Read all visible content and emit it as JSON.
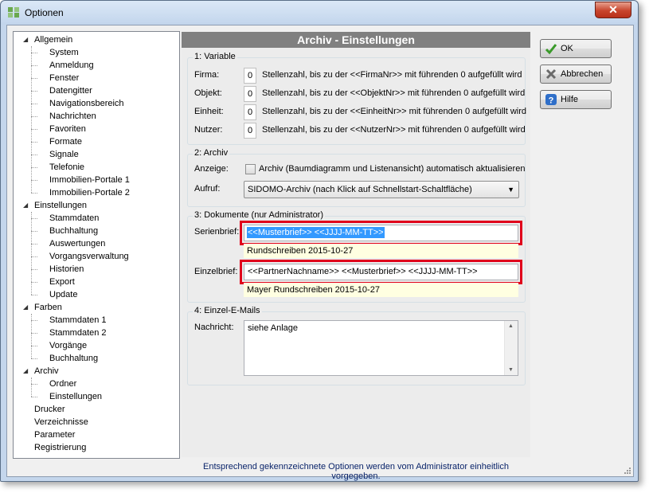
{
  "window": {
    "title": "Optionen",
    "close_glyph": "✕"
  },
  "tree": [
    {
      "label": "Allgemein",
      "level": 0,
      "expanded": true
    },
    {
      "label": "System",
      "level": 1
    },
    {
      "label": "Anmeldung",
      "level": 1
    },
    {
      "label": "Fenster",
      "level": 1
    },
    {
      "label": "Datengitter",
      "level": 1
    },
    {
      "label": "Navigationsbereich",
      "level": 1
    },
    {
      "label": "Nachrichten",
      "level": 1
    },
    {
      "label": "Favoriten",
      "level": 1
    },
    {
      "label": "Formate",
      "level": 1
    },
    {
      "label": "Signale",
      "level": 1
    },
    {
      "label": "Telefonie",
      "level": 1
    },
    {
      "label": "Immobilien-Portale 1",
      "level": 1
    },
    {
      "label": "Immobilien-Portale 2",
      "level": 1
    },
    {
      "label": "Einstellungen",
      "level": 0,
      "expanded": true
    },
    {
      "label": "Stammdaten",
      "level": 1
    },
    {
      "label": "Buchhaltung",
      "level": 1
    },
    {
      "label": "Auswertungen",
      "level": 1
    },
    {
      "label": "Vorgangsverwaltung",
      "level": 1
    },
    {
      "label": "Historien",
      "level": 1
    },
    {
      "label": "Export",
      "level": 1
    },
    {
      "label": "Update",
      "level": 1
    },
    {
      "label": "Farben",
      "level": 0,
      "expanded": true
    },
    {
      "label": "Stammdaten 1",
      "level": 1
    },
    {
      "label": "Stammdaten 2",
      "level": 1
    },
    {
      "label": "Vorgänge",
      "level": 1
    },
    {
      "label": "Buchhaltung",
      "level": 1
    },
    {
      "label": "Archiv",
      "level": 0,
      "expanded": true
    },
    {
      "label": "Ordner",
      "level": 1
    },
    {
      "label": "Einstellungen",
      "level": 1,
      "selected": true
    },
    {
      "label": "Drucker",
      "level": 0
    },
    {
      "label": "Verzeichnisse",
      "level": 0
    },
    {
      "label": "Parameter",
      "level": 0
    },
    {
      "label": "Registrierung",
      "level": 0
    }
  ],
  "panel": {
    "title": "Archiv - Einstellungen",
    "variable": {
      "title": "1: Variable",
      "rows": [
        {
          "label": "Firma:",
          "value": "0",
          "desc": "Stellenzahl, bis zu der <<FirmaNr>> mit führenden 0 aufgefüllt wird"
        },
        {
          "label": "Objekt:",
          "value": "0",
          "desc": "Stellenzahl, bis zu der <<ObjektNr>> mit führenden 0 aufgefüllt wird"
        },
        {
          "label": "Einheit:",
          "value": "0",
          "desc": "Stellenzahl, bis zu der <<EinheitNr>> mit führenden 0 aufgefüllt wird"
        },
        {
          "label": "Nutzer:",
          "value": "0",
          "desc": "Stellenzahl, bis zu der <<NutzerNr>> mit führenden 0 aufgefüllt wird"
        }
      ]
    },
    "archiv": {
      "title": "2: Archiv",
      "anzeige_label": "Anzeige:",
      "anzeige_checkbox": "Archiv (Baumdiagramm und Listenansicht) automatisch aktualisieren",
      "aufruf_label": "Aufruf:",
      "aufruf_value": "SIDOMO-Archiv (nach Klick auf Schnellstart-Schaltfläche)"
    },
    "dokumente": {
      "title": "3: Dokumente  (nur Administrator)",
      "serienbrief_label": "Serienbrief:",
      "serienbrief_value": "<<Musterbrief>> <<JJJJ-MM-TT>>",
      "serienbrief_preview": "Rundschreiben 2015-10-27",
      "einzelbrief_label": "Einzelbrief:",
      "einzelbrief_value": "<<PartnerNachname>> <<Musterbrief>> <<JJJJ-MM-TT>>",
      "einzelbrief_preview": "Mayer Rundschreiben 2015-10-27"
    },
    "emails": {
      "title": "4: Einzel-E-Mails",
      "nachricht_label": "Nachricht:",
      "nachricht_value": "siehe Anlage"
    }
  },
  "buttons": {
    "ok": "OK",
    "abbrechen": "Abbrechen",
    "hilfe": "Hilfe"
  },
  "footer": "Entsprechend gekennzeichnete Optionen werden vom Administrator einheitlich vorgegeben.",
  "colors": {
    "header_bg": "#808080",
    "highlight_red": "#e0001b",
    "selection_blue": "#3399ff",
    "preview_bg": "#ffffe1",
    "footer_text": "#0a246a"
  }
}
